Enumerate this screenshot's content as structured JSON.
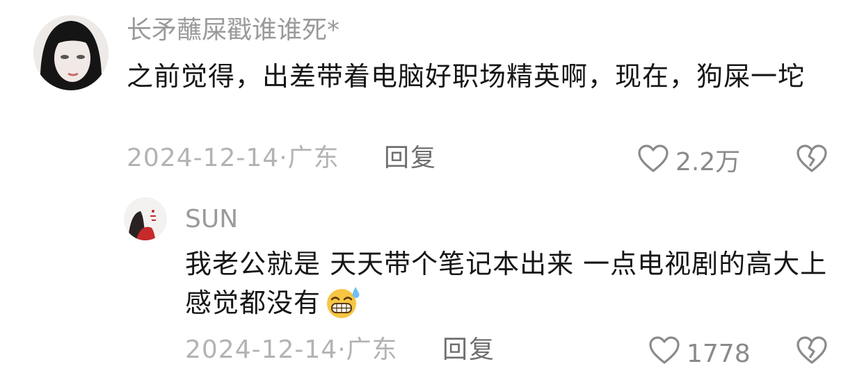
{
  "comments": [
    {
      "username": "长矛蘸屎戳谁谁死*",
      "text": "之前觉得，出差带着电脑好职场精英啊，现在，狗屎一坨",
      "date": "2024-12-14",
      "location": "广东",
      "reply_label": "回复",
      "like_count": "2.2万",
      "avatar_icon": "user-avatar",
      "like_icon": "heart-outline-icon",
      "dislike_icon": "broken-heart-icon"
    },
    {
      "username": "SUN",
      "text": "我老公就是 天天带个笔记本出来 一点电视剧的高大上感觉都没有",
      "emoji": "grinning-sweat-emoji",
      "date": "2024-12-14",
      "location": "广东",
      "reply_label": "回复",
      "like_count": "1778",
      "avatar_icon": "user-avatar",
      "like_icon": "heart-outline-icon",
      "dislike_icon": "broken-heart-icon"
    }
  ],
  "colors": {
    "username": "#9a9a9a",
    "text": "#161616",
    "meta": "#b3b3b3",
    "reply": "#6f6f6f",
    "icon": "#8a8a8a"
  }
}
